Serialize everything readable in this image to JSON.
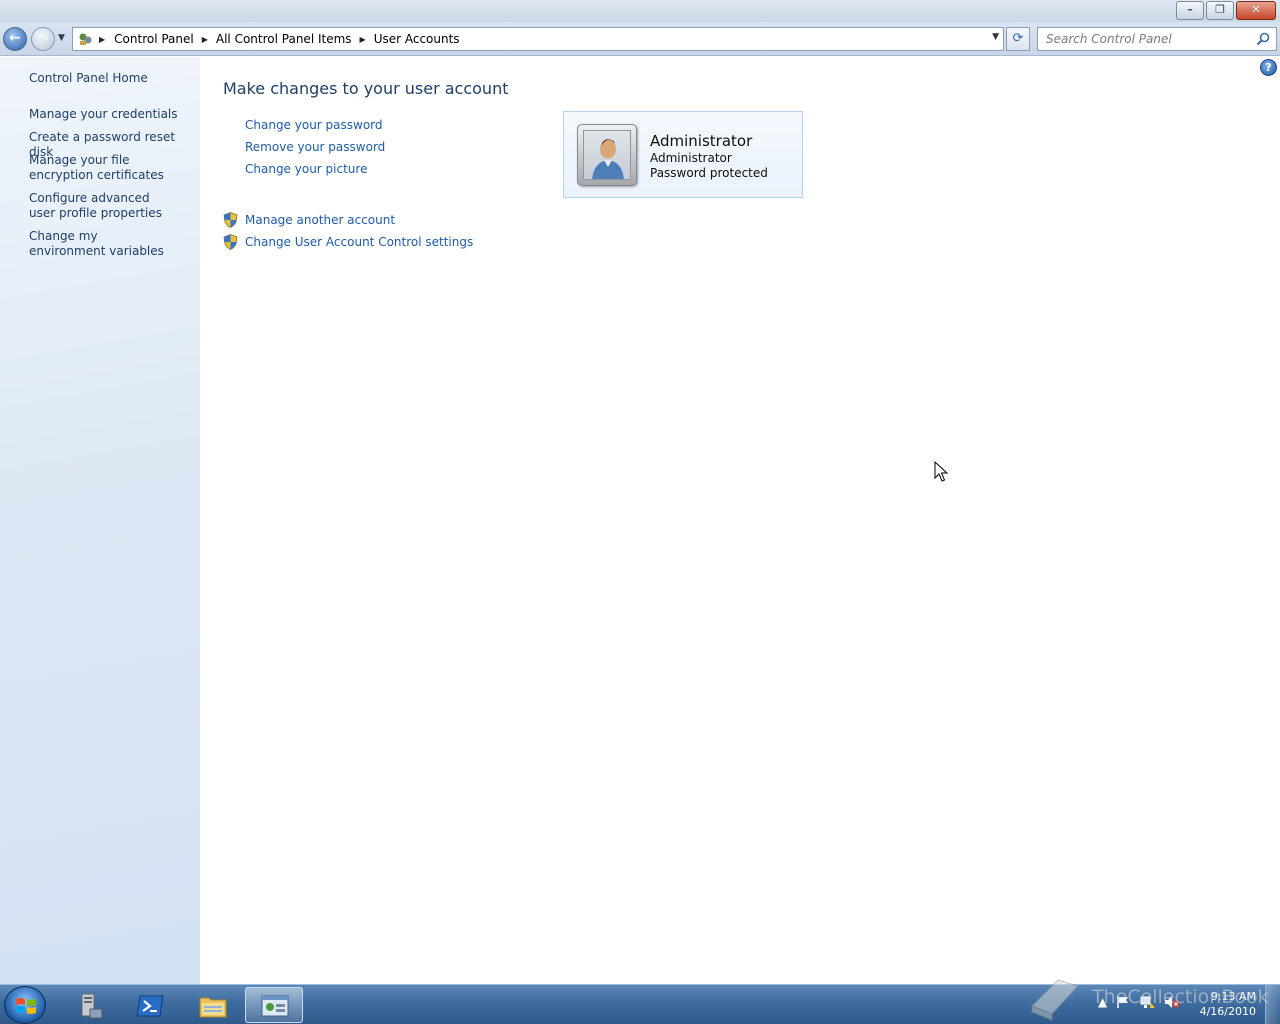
{
  "window": {
    "minimize_glyph": "–",
    "restore_glyph": "❐",
    "close_glyph": "✕"
  },
  "nav": {
    "back_glyph": "←",
    "forward_glyph": "→",
    "recent_glyph": "▼",
    "address": {
      "crumbs": [
        "Control Panel",
        "All Control Panel Items",
        "User Accounts"
      ],
      "separator_glyph": "▶",
      "dropdown_glyph": "▼"
    },
    "refresh_glyph": "⟳",
    "search": {
      "placeholder": "Search Control Panel",
      "value": ""
    }
  },
  "left_pane": {
    "links": [
      "Control Panel Home",
      "Manage your credentials",
      "Create a password reset disk",
      "Manage your file encryption certificates",
      "Configure advanced user profile properties",
      "Change my environment variables"
    ]
  },
  "main": {
    "help_glyph": "?",
    "heading": "Make changes to your user account",
    "tasks": [
      "Change your password",
      "Remove your password",
      "Change your picture"
    ],
    "admin_tasks": [
      "Manage another account",
      "Change User Account Control settings"
    ],
    "account": {
      "name": "Administrator",
      "role": "Administrator",
      "status": "Password protected"
    }
  },
  "taskbar": {
    "items": [
      "server-manager",
      "powershell",
      "windows-explorer",
      "control-panel"
    ],
    "active_item": "control-panel",
    "tray": {
      "show_hidden_glyph": "▲"
    },
    "clock": {
      "time": "9:13 AM",
      "date": "4/16/2010"
    },
    "watermark": "TheCollectionBook"
  },
  "colors": {
    "link": "#1f5aa7",
    "heading": "#1e3f66",
    "taskbar": "#3f6c9f"
  }
}
